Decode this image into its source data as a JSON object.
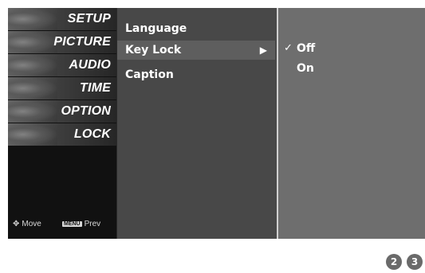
{
  "menu": {
    "items": [
      {
        "label": "SETUP",
        "icon": "setup-thumbnail-icon"
      },
      {
        "label": "PICTURE",
        "icon": "picture-thumbnail-icon"
      },
      {
        "label": "AUDIO",
        "icon": "audio-thumbnail-icon"
      },
      {
        "label": "TIME",
        "icon": "time-thumbnail-icon"
      },
      {
        "label": "OPTION",
        "icon": "option-thumbnail-icon"
      },
      {
        "label": "LOCK",
        "icon": "lock-thumbnail-icon"
      }
    ],
    "hints": {
      "move_label": "Move",
      "menu_key": "MENU",
      "prev_label": "Prev"
    }
  },
  "submenu": {
    "items": [
      {
        "label": "Language"
      },
      {
        "label": "Key Lock"
      },
      {
        "label": "Caption"
      }
    ],
    "selected_index": 1,
    "arrow": "▶"
  },
  "options": {
    "items": [
      {
        "label": "Off",
        "checked": true
      },
      {
        "label": "On",
        "checked": false
      }
    ],
    "check_glyph": "✓"
  },
  "page_numbers": [
    "2",
    "3"
  ],
  "colors": {
    "menu_bg": "#111111",
    "submenu_bg": "#484848",
    "options_bg": "#6e6e6e",
    "divider": "#d0d0d0",
    "page_number_bg": "#6a6a6a"
  }
}
